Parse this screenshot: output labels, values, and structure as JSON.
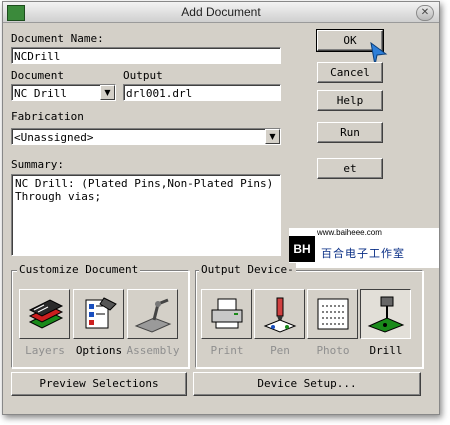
{
  "window": {
    "title": "Add Document"
  },
  "fields": {
    "document_name_label": "Document Name:",
    "document_name_value": "NCDrill",
    "document_label": "Document",
    "document_value": "NC Drill",
    "output_label": "Output",
    "output_value": "drl001.drl",
    "fabrication_label": "Fabrication",
    "fabrication_value": "<Unassigned>",
    "summary_label": "Summary:",
    "summary_value": "NC Drill: (Plated Pins,Non-Plated Pins)\nThrough vias;"
  },
  "buttons": {
    "ok": "OK",
    "cancel": "Cancel",
    "help": "Help",
    "run": "Run",
    "set_layers": "et Layers..",
    "preview": "Preview Selections",
    "device_setup": "Device Setup..."
  },
  "customize": {
    "title": "Customize Document",
    "items": [
      {
        "label": "Layers",
        "icon": "layers-icon",
        "enabled": false
      },
      {
        "label": "Options",
        "icon": "options-icon",
        "enabled": true
      },
      {
        "label": "Assembly",
        "icon": "assembly-icon",
        "enabled": false
      }
    ]
  },
  "output_device": {
    "title": "Output Device",
    "items": [
      {
        "label": "Print",
        "icon": "printer-icon",
        "enabled": false
      },
      {
        "label": "Pen",
        "icon": "pen-plotter-icon",
        "enabled": false
      },
      {
        "label": "Photo",
        "icon": "photo-plotter-icon",
        "enabled": false
      },
      {
        "label": "Drill",
        "icon": "drill-icon",
        "enabled": true,
        "selected": true
      }
    ]
  },
  "watermark": {
    "url": "www.baiheee.com",
    "brand": "BH",
    "text": "百合电子工作室"
  }
}
